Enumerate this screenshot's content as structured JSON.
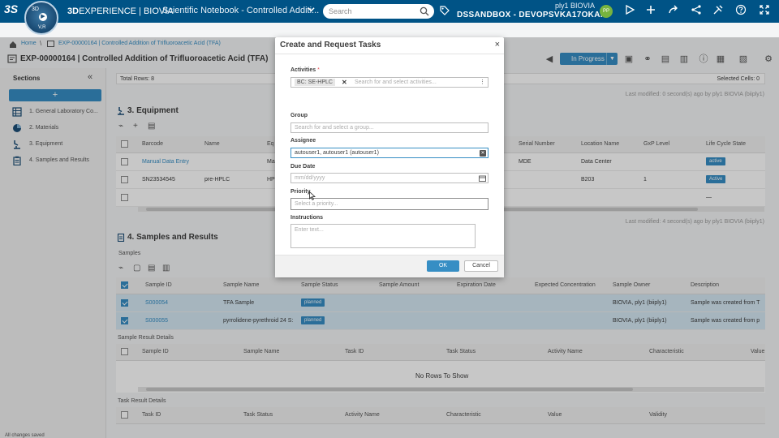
{
  "topbar": {
    "ds_logo": "3S",
    "compass_top": "3D",
    "compass_left": "",
    "compass_right": "",
    "compass_bottom": "V,R",
    "brand_bold": "3D",
    "brand_rest": "EXPERIENCE | BIOVIA",
    "app_title": "Scientific Notebook - Controlled Additi...",
    "search_placeholder": "Search",
    "user_name": "ply1 BIOVIA",
    "tenant": "DSSANDBOX - DEVOPSVKA17OKA...",
    "avatar_initials": "PP"
  },
  "breadcrumb": {
    "home": "Home",
    "experiment": "EXP-00000164 | Controlled Addition of Trifluoroacetic Acid (TFA)"
  },
  "page": {
    "title": "EXP-00000164 | Controlled Addition of Trifluoroacetic Acid (TFA)",
    "status": "In Progress"
  },
  "sidebar": {
    "heading": "Sections",
    "collapse": "«",
    "add": "+",
    "items": [
      {
        "label": "1. General Laboratory Co...",
        "icon": "table-icon"
      },
      {
        "label": "2. Materials",
        "icon": "materials-icon"
      },
      {
        "label": "3. Equipment",
        "icon": "equipment-icon"
      },
      {
        "label": "4. Samples and Results",
        "icon": "clipboard-icon"
      }
    ],
    "footer": "All changes saved"
  },
  "totals": {
    "left": "Total Rows: 8",
    "right": "Selected Cells: 0"
  },
  "equipment": {
    "title": "3. Equipment",
    "last_modified": "Last modified: 0 second(s) ago by ply1 BIOVIA (biiply1)",
    "columns": [
      "Barcode",
      "Name",
      "Eq",
      "Serial Number",
      "Location Name",
      "GxP Level",
      "Life Cycle State"
    ],
    "rows": [
      {
        "barcode": "Manual Data Entry",
        "name": "",
        "eq": "Ma",
        "serial": "MDE",
        "location": "Data Center",
        "gxp": "",
        "state": "active"
      },
      {
        "barcode": "SN23534545",
        "name": "pre-HPLC",
        "eq": "HP",
        "serial": "",
        "location": "B203",
        "gxp": "1",
        "state": "Active"
      },
      {
        "barcode": "",
        "name": "",
        "eq": "",
        "serial": "",
        "location": "",
        "gxp": "",
        "state": "—"
      }
    ]
  },
  "samples": {
    "title": "4. Samples and Results",
    "last_modified": "Last modified: 4 second(s) ago by ply1 BIOVIA (biiply1)",
    "sub": "Samples",
    "columns": [
      "Sample ID",
      "Sample Name",
      "Sample Status",
      "Sample Amount",
      "Expiration Date",
      "Expected Concentration",
      "Sample Owner",
      "Description"
    ],
    "rows": [
      {
        "id": "S000054",
        "name": "TFA Sample",
        "status": "planned",
        "amount": "",
        "exp": "",
        "conc": "",
        "owner": "BIOVIA, ply1 (biiply1)",
        "desc": "Sample was created from T"
      },
      {
        "id": "S000055",
        "name": "pyrrolidene-pyrethroid 24 S:",
        "status": "planned",
        "amount": "",
        "exp": "",
        "conc": "",
        "owner": "BIOVIA, ply1 (biiply1)",
        "desc": "Sample was created from p"
      }
    ]
  },
  "sample_results": {
    "label": "Sample Result Details",
    "columns": [
      "Sample ID",
      "Sample Name",
      "Task ID",
      "Task Status",
      "Activity Name",
      "Characteristic",
      "Value"
    ],
    "empty": "No Rows To Show"
  },
  "task_results": {
    "label": "Task Result Details",
    "columns": [
      "Task ID",
      "Task Status",
      "Activity Name",
      "Characteristic",
      "Value",
      "Validity"
    ]
  },
  "modal": {
    "title": "Create and Request Tasks",
    "close": "×",
    "activities_label": "Activities",
    "required_mark": "*",
    "activity_chip": "BC: SE-HPLC",
    "activities_placeholder": "Search for and select activities...",
    "group_label": "Group",
    "group_placeholder": "Search for and select a group...",
    "assignee_label": "Assignee",
    "assignee_value": "autouser1, autouser1 (autouser1)",
    "due_label": "Due Date",
    "due_placeholder": "mm/dd/yyyy",
    "priority_label": "Priority",
    "priority_placeholder": "Select a priority...",
    "instructions_label": "Instructions",
    "instructions_placeholder": "Enter text...",
    "ok": "OK",
    "cancel": "Cancel"
  },
  "colors": {
    "topbar": "#005386",
    "accent": "#368ec4",
    "avatar": "#77b43f"
  }
}
